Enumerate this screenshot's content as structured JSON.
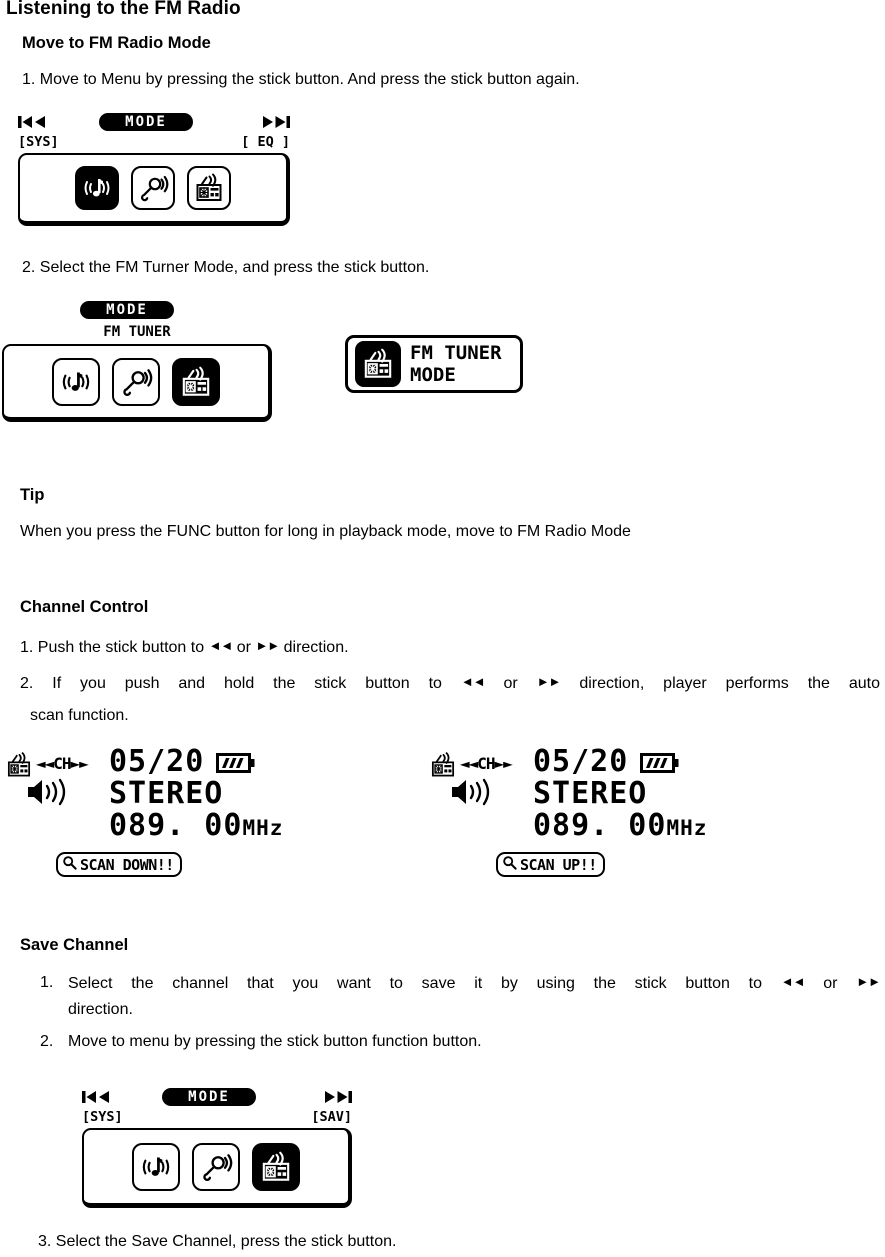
{
  "document": {
    "title": "Listening to the FM Radio",
    "sections": {
      "move_mode": {
        "heading": "Move to FM Radio Mode",
        "step1": "1. Move to Menu by pressing the stick button. And press the stick button again.",
        "step2": "2. Select the FM Turner Mode, and press the stick button."
      },
      "tip": {
        "heading": "Tip",
        "text": "When you press the FUNC button for long in playback mode, move to FM Radio Mode"
      },
      "channel_control": {
        "heading": "Channel Control",
        "step1_a": "1. Push the stick button to",
        "step1_arrow_left": "◄◄",
        "step1_or": "or",
        "step1_arrow_right": "►►",
        "step1_b": "direction.",
        "step2_a": "2. If you push and hold the stick button to",
        "step2_or": "or",
        "step2_b": "direction, player performs the auto",
        "step2_c": "scan function."
      },
      "save_channel": {
        "heading": "Save Channel",
        "item1_marker": "1.",
        "item1_a": "Select the channel that you want to save it by using the stick button to",
        "item1_or": "or",
        "item1_b": "direction.",
        "item2_marker": "2.",
        "item2": "Move to menu by pressing the stick button function button.",
        "step3": "3. Select the Save Channel, press the stick button."
      }
    }
  },
  "screens": {
    "menu_eq": {
      "prev_icon": "⏮",
      "next_icon": "⏭",
      "mode_pill": "MODE",
      "left_tag": "[SYS]",
      "right_tag": "[ EQ ]",
      "icons": [
        {
          "name": "music-mode-icon",
          "selected": true
        },
        {
          "name": "voice-record-mode-icon",
          "selected": false
        },
        {
          "name": "fm-radio-mode-icon",
          "selected": false
        }
      ]
    },
    "menu_fmtuner": {
      "mode_pill": "MODE",
      "center_label": "FM TUNER",
      "icons": [
        {
          "name": "music-mode-icon",
          "selected": false
        },
        {
          "name": "voice-record-mode-icon",
          "selected": false
        },
        {
          "name": "fm-radio-mode-icon",
          "selected": true
        }
      ]
    },
    "menu_sav": {
      "prev_icon": "⏮",
      "next_icon": "⏭",
      "mode_pill": "MODE",
      "left_tag": "[SYS]",
      "right_tag": "[SAV]",
      "icons": [
        {
          "name": "music-mode-icon",
          "selected": false
        },
        {
          "name": "voice-record-mode-icon",
          "selected": false
        },
        {
          "name": "fm-radio-mode-icon",
          "selected": true
        }
      ]
    },
    "toast_fmtuner": {
      "line1": "FM TUNER",
      "line2": "MODE"
    },
    "fm_display_down": {
      "channel_label": "◄◄CH►►",
      "line1": "05/20",
      "line2": "STEREO",
      "freq": "089. 00",
      "freq_unit": "MHz",
      "scan_badge": "SCAN DOWN!!"
    },
    "fm_display_up": {
      "channel_label": "◄◄CH►►",
      "line1": "05/20",
      "line2": "STEREO",
      "freq": "089. 00",
      "freq_unit": "MHz",
      "scan_badge": "SCAN UP!!"
    }
  },
  "colors": {
    "ink": "#000000",
    "paper": "#ffffff"
  }
}
